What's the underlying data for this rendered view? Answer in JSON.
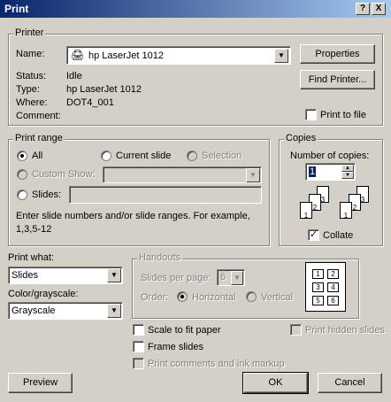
{
  "dialog": {
    "title": "Print",
    "help": "?",
    "close": "X"
  },
  "printer": {
    "group_label": "Printer",
    "name_label": "Name:",
    "name_value": "hp LaserJet 1012",
    "properties_button": "Properties",
    "find_printer_button": "Find Printer...",
    "status_label": "Status:",
    "status_value": "Idle",
    "type_label": "Type:",
    "type_value": "hp LaserJet 1012",
    "where_label": "Where:",
    "where_value": "DOT4_001",
    "comment_label": "Comment:",
    "comment_value": "",
    "print_to_file_label": "Print to file",
    "print_to_file_checked": false
  },
  "range": {
    "group_label": "Print range",
    "all_label": "All",
    "current_slide_label": "Current slide",
    "selection_label": "Selection",
    "custom_show_label": "Custom Show:",
    "slides_label": "Slides:",
    "slides_value": "",
    "selected": "All",
    "hint": "Enter slide numbers and/or slide ranges. For example, 1,3,5-12"
  },
  "copies": {
    "group_label": "Copies",
    "number_label": "Number of copies:",
    "number_value": "1",
    "collate_label": "Collate",
    "collate_checked": true
  },
  "print_what": {
    "label": "Print what:",
    "value": "Slides"
  },
  "color": {
    "label": "Color/grayscale:",
    "value": "Grayscale"
  },
  "handouts": {
    "group_label": "Handouts",
    "slides_per_page_label": "Slides per page:",
    "slides_per_page_value": "6",
    "order_label": "Order:",
    "horizontal_label": "Horizontal",
    "vertical_label": "Vertical",
    "preview_pages": [
      "1",
      "2",
      "3",
      "4",
      "5",
      "6"
    ]
  },
  "options": {
    "scale_to_fit": "Scale to fit paper",
    "frame_slides": "Frame slides",
    "print_comments": "Print comments and ink markup",
    "print_hidden": "Print hidden slides"
  },
  "buttons": {
    "preview": "Preview",
    "ok": "OK",
    "cancel": "Cancel"
  }
}
